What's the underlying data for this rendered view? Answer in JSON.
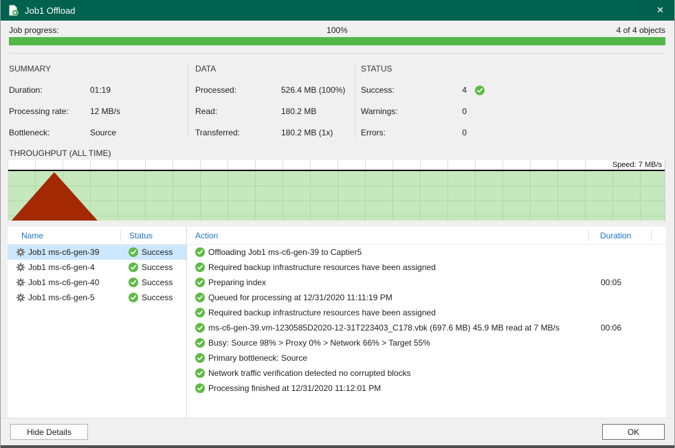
{
  "window": {
    "title": "Job1 Offload",
    "close_glyph": "✕"
  },
  "progress": {
    "label": "Job progress:",
    "percent": "100%",
    "objects_count": "4 of 4 objects",
    "value": 100
  },
  "summary": {
    "heading": "SUMMARY",
    "rows": [
      {
        "label": "Duration:",
        "value": "01:19"
      },
      {
        "label": "Processing rate:",
        "value": "12 MB/s"
      },
      {
        "label": "Bottleneck:",
        "value": "Source"
      }
    ]
  },
  "data_section": {
    "heading": "DATA",
    "rows": [
      {
        "label": "Processed:",
        "value": "526.4 MB (100%)"
      },
      {
        "label": "Read:",
        "value": "180.2 MB"
      },
      {
        "label": "Transferred:",
        "value": "180.2 MB (1x)"
      }
    ]
  },
  "status_section": {
    "heading": "STATUS",
    "rows": [
      {
        "label": "Success:",
        "value": "4",
        "icon": "success-check-icon"
      },
      {
        "label": "Warnings:",
        "value": "0"
      },
      {
        "label": "Errors:",
        "value": "0"
      }
    ]
  },
  "throughput": {
    "heading": "THROUGHPUT (ALL TIME)",
    "speed_label": "Speed: 7 MB/s"
  },
  "chart_data": {
    "type": "area",
    "title": "THROUGHPUT (ALL TIME)",
    "annotation": "Speed: 7 MB/s",
    "grid": true,
    "plot_background": "#c5e8bd",
    "series": [
      {
        "name": "throughput-spike",
        "color": "#a42902",
        "points_pct": [
          {
            "x": 0.5,
            "y": 0
          },
          {
            "x": 7.0,
            "y": 98
          },
          {
            "x": 13.6,
            "y": 0
          }
        ]
      }
    ],
    "note": "Single triangular red spike at far left of timeline, peak speed 7 MB/s; rest of timeline flat at zero"
  },
  "vm_table": {
    "columns": [
      "Name",
      "Status"
    ],
    "rows": [
      {
        "name": "Job1 ms-c6-gen-39",
        "status": "Success",
        "selected": true
      },
      {
        "name": "Job1 ms-c6-gen-4",
        "status": "Success",
        "selected": false
      },
      {
        "name": "Job1 ms-c6-gen-40",
        "status": "Success",
        "selected": false
      },
      {
        "name": "Job1 ms-c6-gen-5",
        "status": "Success",
        "selected": false
      }
    ]
  },
  "action_log": {
    "columns": [
      "Action",
      "Duration"
    ],
    "rows": [
      {
        "action": "Offloading Job1 ms-c6-gen-39 to Captier5",
        "duration": ""
      },
      {
        "action": "Required backup infrastructure resources have been assigned",
        "duration": ""
      },
      {
        "action": "Preparing index",
        "duration": "00:05"
      },
      {
        "action": "Queued for processing at 12/31/2020 11:11:19 PM",
        "duration": ""
      },
      {
        "action": "Required backup infrastructure resources have been assigned",
        "duration": ""
      },
      {
        "action": "ms-c6-gen-39.vm-1230585D2020-12-31T223403_C178.vbk (697.6 MB) 45.9 MB read at 7 MB/s",
        "duration": "00:06"
      },
      {
        "action": "Busy: Source 98% > Proxy 0% > Network 66% > Target 55%",
        "duration": ""
      },
      {
        "action": "Primary bottleneck: Source",
        "duration": ""
      },
      {
        "action": "Network traffic verification detected no corrupted blocks",
        "duration": ""
      },
      {
        "action": "Processing finished at 12/31/2020 11:12:01 PM",
        "duration": ""
      }
    ]
  },
  "footer": {
    "hide_details_label": "Hide Details",
    "ok_label": "OK"
  },
  "colors": {
    "titlebar_green": "#00614e",
    "progress_green": "#54b748",
    "chart_fill_green": "#c5e8bd",
    "spike_red": "#a42902",
    "selection_blue": "#cce8ff",
    "success_green": "#5fba46",
    "header_blue": "#1c70c0",
    "gear_gray": "#6e6e6e"
  }
}
